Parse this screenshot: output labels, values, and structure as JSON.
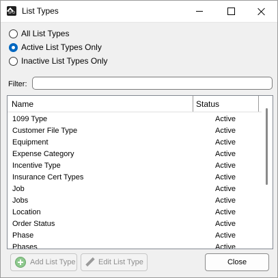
{
  "window": {
    "title": "List Types",
    "app_icon": "emblem-icon",
    "icon_text": "SPD"
  },
  "filter_options": [
    {
      "label": "All List Types",
      "checked": false
    },
    {
      "label": "Active List Types Only",
      "checked": true
    },
    {
      "label": "Inactive List Types Only",
      "checked": false
    }
  ],
  "filter": {
    "label": "Filter:",
    "value": ""
  },
  "list": {
    "columns": {
      "name": "Name",
      "status": "Status"
    },
    "rows": [
      {
        "name": "1099 Type",
        "status": "Active"
      },
      {
        "name": "Customer File Type",
        "status": "Active"
      },
      {
        "name": "Equipment",
        "status": "Active"
      },
      {
        "name": "Expense Category",
        "status": "Active"
      },
      {
        "name": "Incentive Type",
        "status": "Active"
      },
      {
        "name": "Insurance Cert Types",
        "status": "Active"
      },
      {
        "name": "Job",
        "status": "Active"
      },
      {
        "name": "Jobs",
        "status": "Active"
      },
      {
        "name": "Location",
        "status": "Active"
      },
      {
        "name": "Order Status",
        "status": "Active"
      },
      {
        "name": "Phase",
        "status": "Active"
      },
      {
        "name": "Phases",
        "status": "Active"
      }
    ]
  },
  "buttons": {
    "add": "Add List Type",
    "edit": "Edit List Type",
    "close": "Close"
  },
  "colors": {
    "accent": "#0067c0",
    "window_bg": "#f0f0f0",
    "add_icon": "#8fc98f"
  }
}
